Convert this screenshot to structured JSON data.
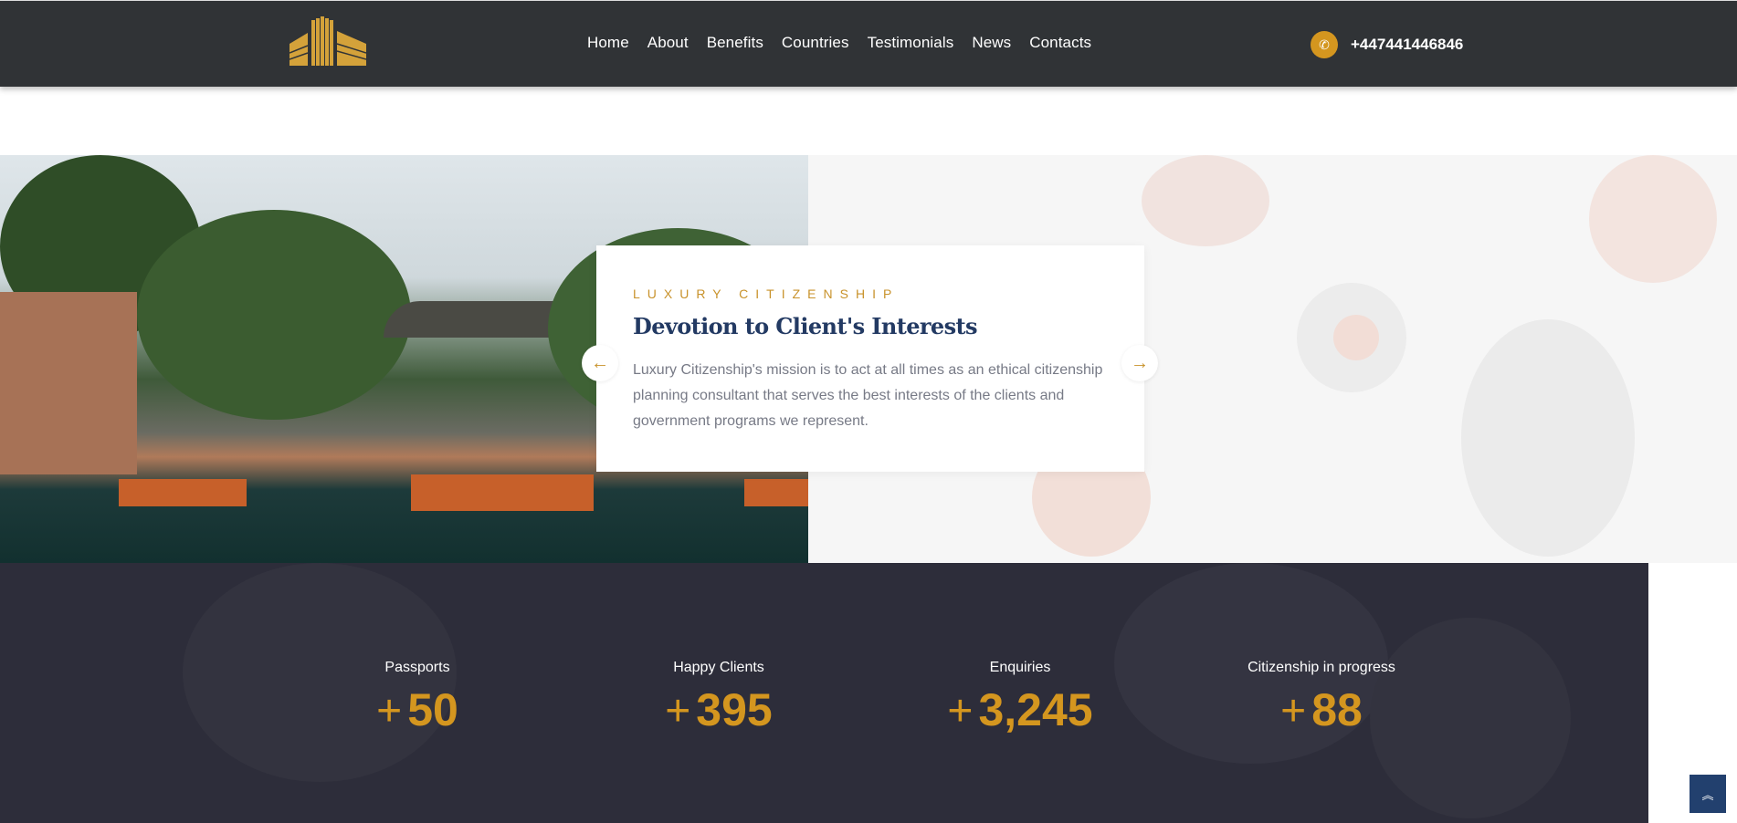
{
  "header": {
    "logo_alt": "building logo",
    "nav": [
      "Home",
      "About",
      "Benefits",
      "Countries",
      "Testimonials",
      "News",
      "Contacts"
    ],
    "phone": "+447441446846"
  },
  "hero": {
    "eyebrow": "LUXURY CITIZENSHIP",
    "title": "Devotion to Client's Interests",
    "description": "Luxury Citizenship's mission is to act at all times as an ethical citizenship planning consultant that serves the best interests of the clients and government programs we represent.",
    "prev_icon": "arrow-left",
    "next_icon": "arrow-right"
  },
  "stats": [
    {
      "label": "Passports",
      "prefix": "+",
      "value": "50"
    },
    {
      "label": "Happy Clients",
      "prefix": "+",
      "value": "395"
    },
    {
      "label": "Enquiries",
      "prefix": "+",
      "value": "3,245"
    },
    {
      "label": "Citizenship in progress",
      "prefix": "+",
      "value": "88"
    }
  ],
  "colors": {
    "accent": "#d4961f",
    "header_bg": "#303336",
    "title": "#233a63",
    "stats_bg": "#2d2d3a",
    "scroll_top_bg": "#22406e"
  }
}
